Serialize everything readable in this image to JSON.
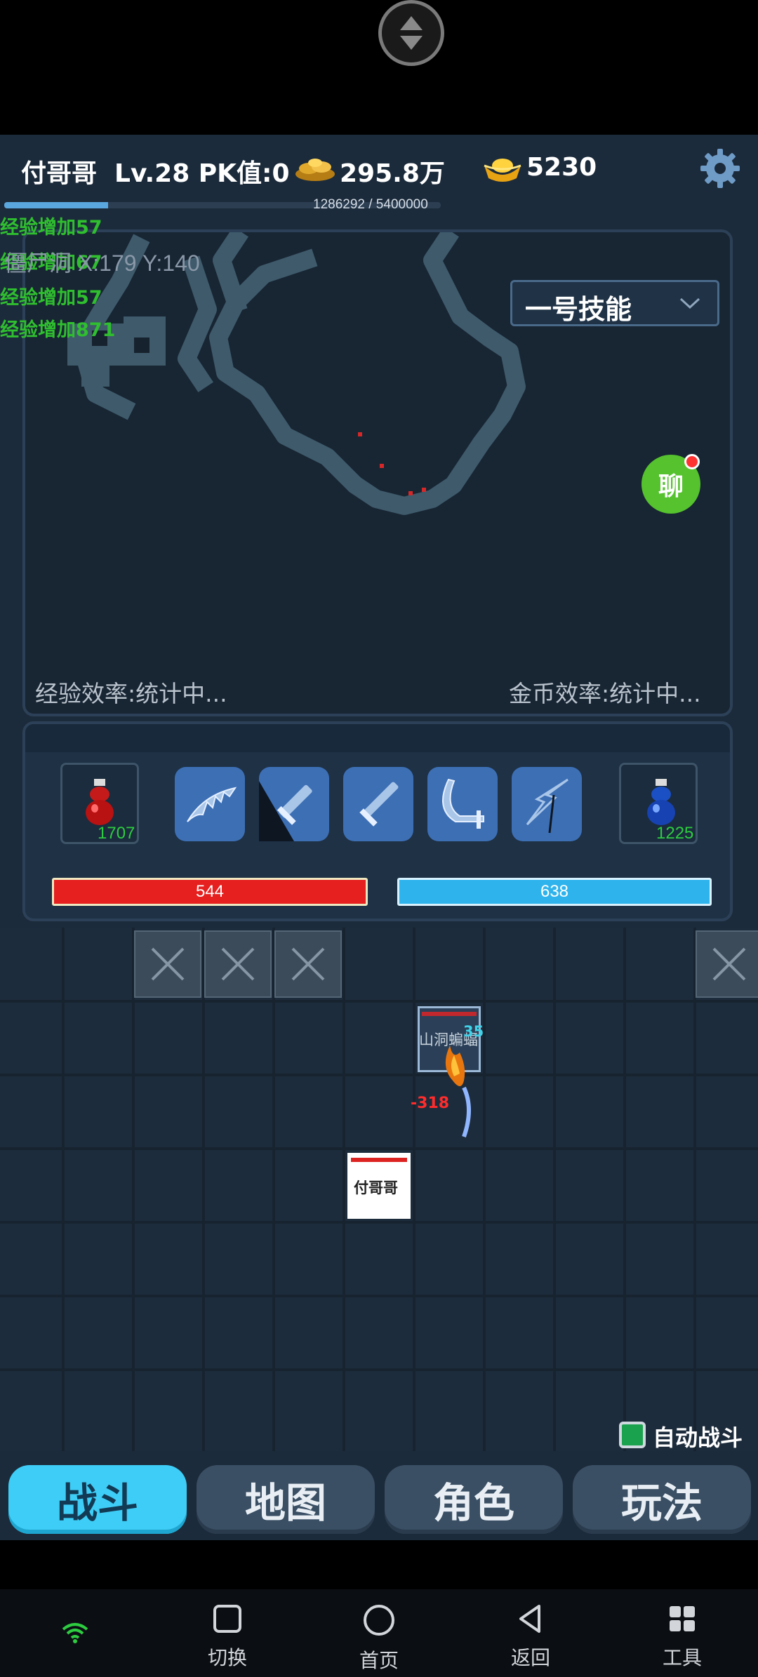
{
  "header": {
    "player_name": "付哥哥",
    "level_pk": "Lv.28 PK值:0",
    "gold": "295.8万",
    "ingots": "5230",
    "exp_text": "1286292 / 5400000",
    "exp_progress": 0.238
  },
  "map": {
    "exp_logs": [
      "经验增加57",
      "经验增加67",
      "经验增加57",
      "经验增加871"
    ],
    "location": "僵尸洞 X:179 Y:140",
    "skill_select": "一号技能",
    "chat_label": "聊",
    "exp_efficiency": "经验效率:统计中...",
    "gold_efficiency": "金币效率:统计中..."
  },
  "skills": {
    "hp_potion_count": "1707",
    "mp_potion_count": "1225",
    "hp": "544",
    "mp": "638",
    "icons": [
      "claw-slash-icon",
      "sword-slash-icon",
      "sword-icon",
      "crescent-sword-icon",
      "lightning-icon"
    ]
  },
  "battle": {
    "monster_name": "山洞蝙蝠",
    "monster_number": "35",
    "damage": "-318",
    "player_tile_name": "付哥哥",
    "auto_battle": "自动战斗"
  },
  "tabs": [
    "战斗",
    "地图",
    "角色",
    "玩法"
  ],
  "nav": [
    "切换",
    "首页",
    "返回",
    "工具"
  ],
  "colors": {
    "background": "#1c2b3b",
    "active_tab": "#3ecdf6",
    "hp": "#e61f1f",
    "mp": "#2fb3ec",
    "exp_log": "#2fbf2f"
  }
}
